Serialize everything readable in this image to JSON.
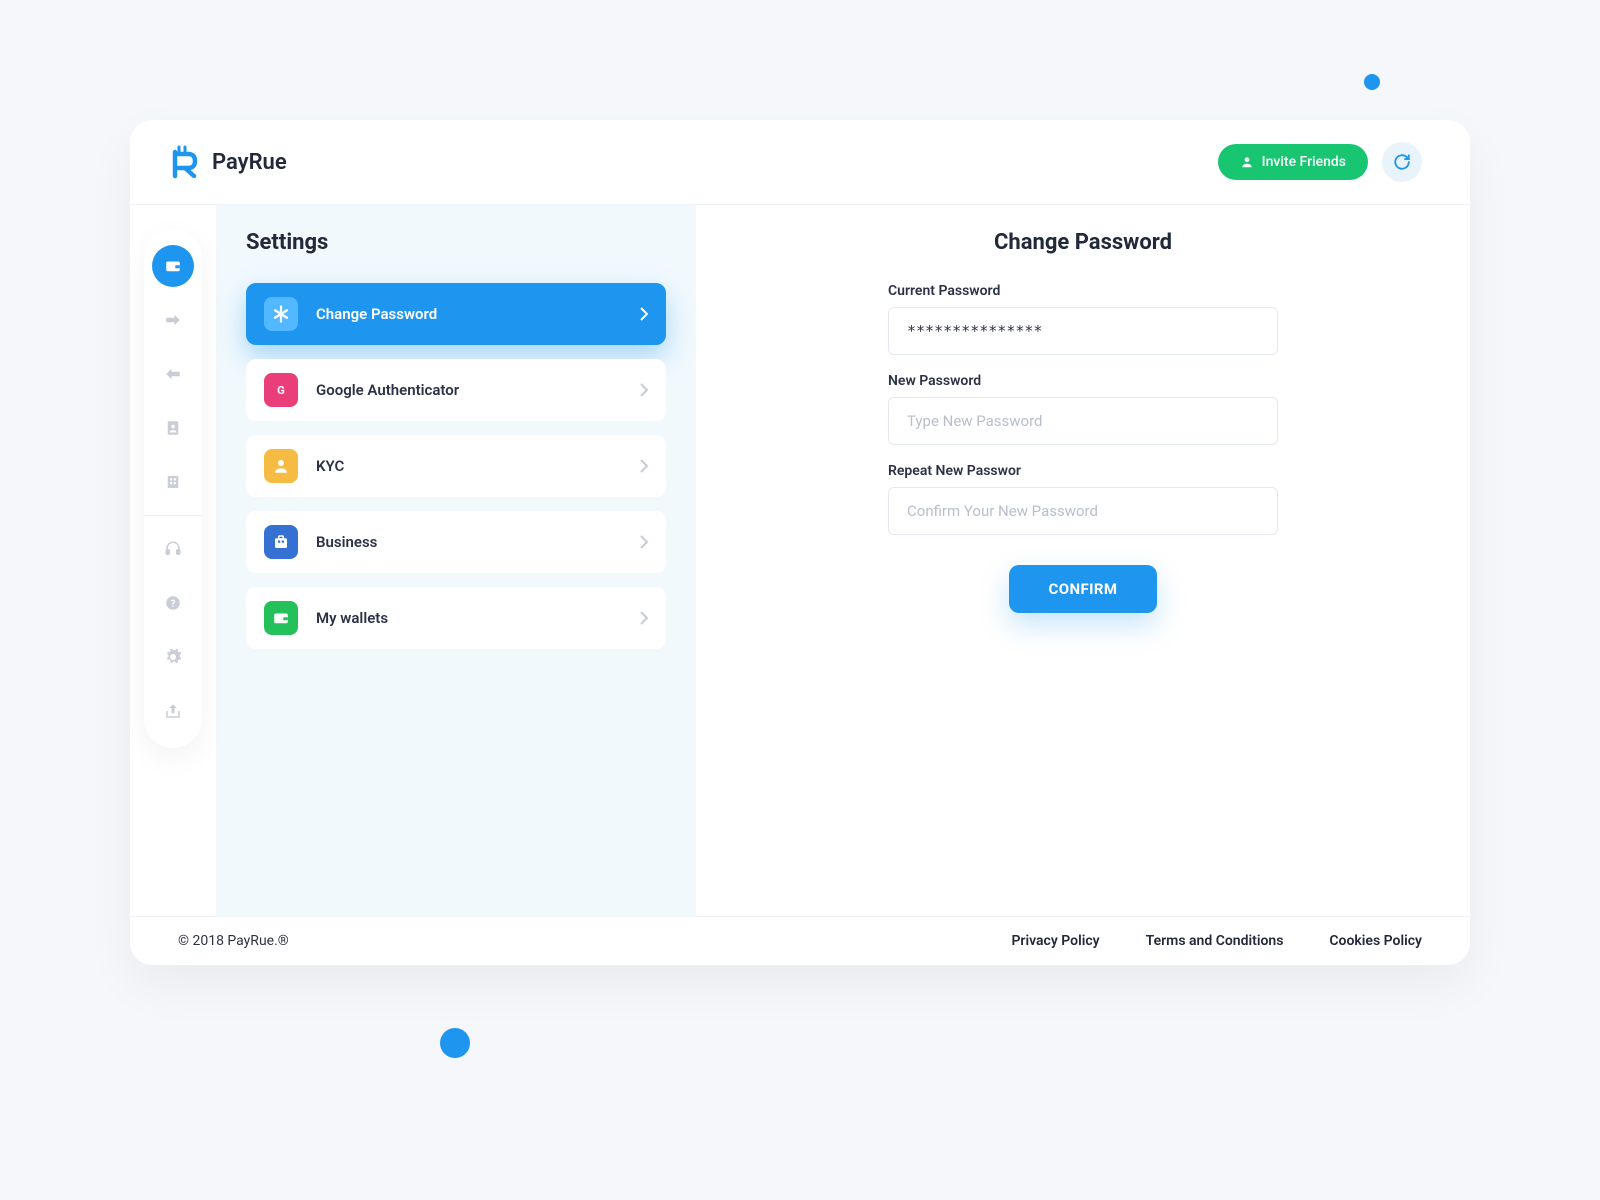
{
  "brand": {
    "name": "PayRue"
  },
  "header": {
    "invite_label": "Invite Friends"
  },
  "rail": {
    "items": [
      {
        "name": "wallet-icon",
        "active": true
      },
      {
        "name": "arrow-right-icon"
      },
      {
        "name": "arrow-left-icon"
      },
      {
        "name": "contact-icon"
      },
      {
        "name": "building-icon"
      }
    ],
    "secondary": [
      {
        "name": "headset-icon"
      },
      {
        "name": "help-icon"
      },
      {
        "name": "gear-icon"
      },
      {
        "name": "share-icon"
      }
    ]
  },
  "settings": {
    "title": "Settings",
    "items": [
      {
        "label": "Change Password",
        "icon": "asterisk-icon",
        "color": "blue-light",
        "active": true
      },
      {
        "label": "Google Authenticator",
        "icon": "google-icon",
        "color": "pink"
      },
      {
        "label": "KYC",
        "icon": "person-icon",
        "color": "amber"
      },
      {
        "label": "Business",
        "icon": "briefcase-icon",
        "color": "blue"
      },
      {
        "label": "My wallets",
        "icon": "wallet-icon",
        "color": "green"
      }
    ]
  },
  "content": {
    "title": "Change Password",
    "fields": {
      "current": {
        "label": "Current Password",
        "value": "***************"
      },
      "new": {
        "label": "New Password",
        "placeholder": "Type New Password"
      },
      "repeat": {
        "label": "Repeat New Passwor",
        "placeholder": "Confirm Your New Password"
      }
    },
    "confirm_label": "CONFIRM"
  },
  "footer": {
    "copyright": "© 2018 PayRue.®",
    "links": [
      "Privacy Policy",
      "Terms and Conditions",
      "Cookies Policy"
    ]
  }
}
